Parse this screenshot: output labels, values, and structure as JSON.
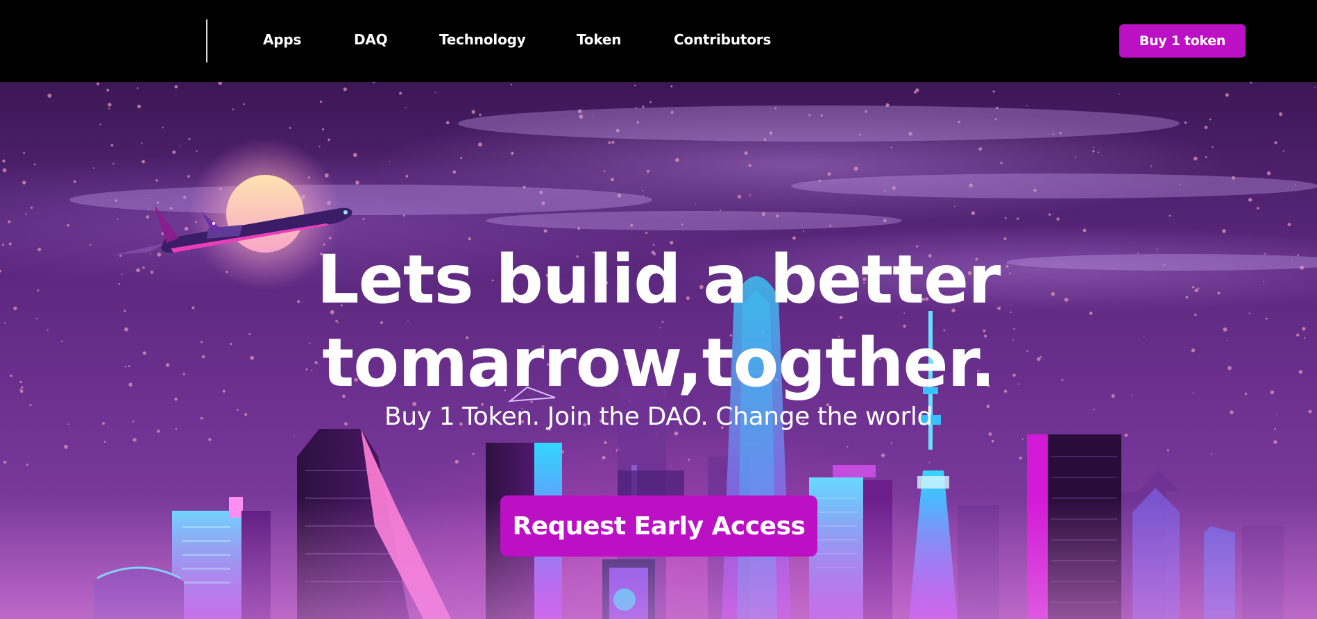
{
  "header": {
    "nav": [
      "Apps",
      "DAQ",
      "Technology",
      "Token",
      "Contributors"
    ],
    "buy_button": "Buy 1 token"
  },
  "hero": {
    "headline_line1": "Lets bulid a better",
    "headline_line2": "tomarrow,togther.",
    "subheadline": "Buy 1 Token. Join the DAO. Change the world",
    "cta": "Request Early Access"
  },
  "colors": {
    "accent": "#bb10c4",
    "header_bg": "#000000",
    "sky_top": "#3c1756",
    "sky_bottom": "#8a3fa0"
  },
  "illustration": {
    "moon": "moon-icon",
    "airplane": "airplane-icon"
  }
}
